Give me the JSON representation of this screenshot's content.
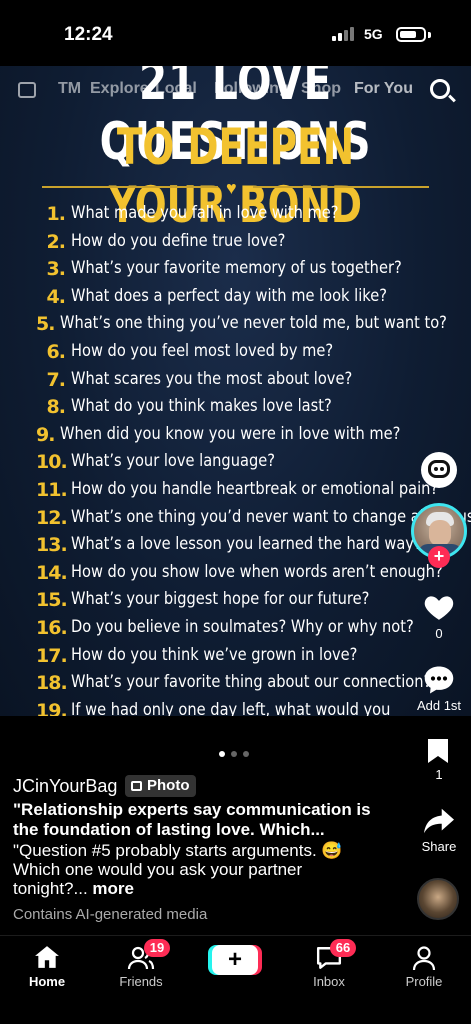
{
  "status": {
    "time": "12:24",
    "network": "5G"
  },
  "topnav": {
    "items": [
      "LIVE",
      "TM",
      "Explore",
      "Local",
      "Following",
      "Shop",
      "For You"
    ]
  },
  "poster": {
    "title_line1": "21 LOVE QUESTIONS",
    "title_line2": "TO DEEPEN YOUR BOND",
    "questions": [
      {
        "n": "1.",
        "q": "What made you fall in love with me?"
      },
      {
        "n": "2.",
        "q": "How do you define true love?"
      },
      {
        "n": "3.",
        "q": "What’s your favorite memory of us together?"
      },
      {
        "n": "4.",
        "q": "What does a perfect day with me look like?"
      },
      {
        "n": "5.",
        "q": "What’s one thing you’ve never told me, but want to?"
      },
      {
        "n": "6.",
        "q": "How do you feel most loved by me?"
      },
      {
        "n": "7.",
        "q": "What scares you the most about love?"
      },
      {
        "n": "8.",
        "q": "What do you think makes love last?"
      },
      {
        "n": "9.",
        "q": "When did you know you were in love with me?"
      },
      {
        "n": "10.",
        "q": "What’s your love language?"
      },
      {
        "n": "11.",
        "q": "How do you handle heartbreak or emotional pain?"
      },
      {
        "n": "12.",
        "q": "What’s one thing you’d never want to change about us?"
      },
      {
        "n": "13.",
        "q": "What’s a love lesson you learned the hard way?"
      },
      {
        "n": "14.",
        "q": "How do you show love when words aren’t enough?"
      },
      {
        "n": "15.",
        "q": "What’s your biggest hope for our future?"
      },
      {
        "n": "16.",
        "q": "Do you believe in soulmates? Why or why not?"
      },
      {
        "n": "17.",
        "q": "How do you think we’ve grown in love?"
      },
      {
        "n": "18.",
        "q": "What’s your favorite thing about our connection?"
      },
      {
        "n": "19.",
        "q": "If we had only one day left, what would you want to do together?"
      }
    ]
  },
  "actions": {
    "likes": "0",
    "comments": "Add 1st",
    "saves": "1",
    "share": "Share"
  },
  "caption": {
    "author": "JCinYourBag",
    "badge": "Photo",
    "title": "\"Relationship experts say communication is the foundation of lasting love. Which...",
    "body": "\"Question #5 probably starts arguments. 😅 Which one would you ask your partner tonight?...",
    "more": "more",
    "ai_note": "Contains AI-generated media"
  },
  "bottomnav": {
    "home": "Home",
    "friends": "Friends",
    "friends_badge": "19",
    "create": "+",
    "inbox": "Inbox",
    "inbox_badge": "66",
    "profile": "Profile"
  },
  "colors": {
    "accent_gold": "#f2c22f",
    "tiktok_red": "#fe2c55",
    "tiktok_cyan": "#25f4ee"
  }
}
